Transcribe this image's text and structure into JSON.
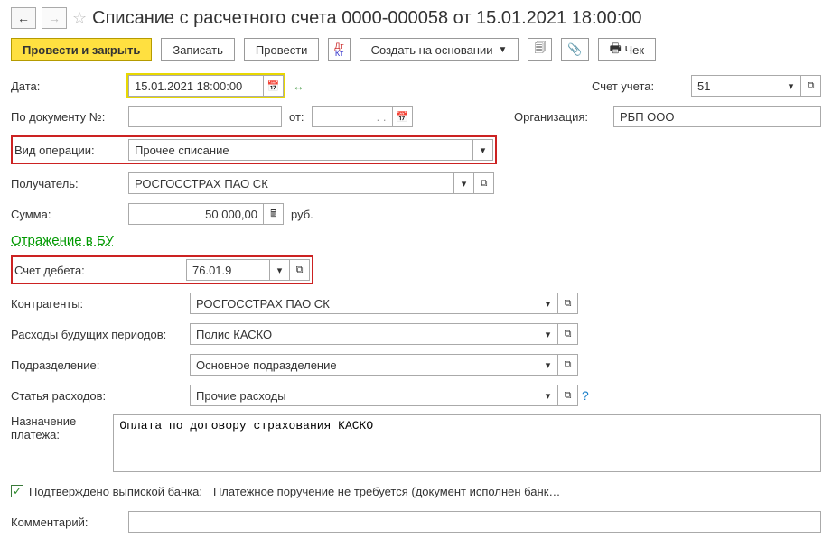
{
  "title": "Списание с расчетного счета 0000-000058 от 15.01.2021 18:00:00",
  "toolbar": {
    "submit_close": "Провести и закрыть",
    "save": "Записать",
    "submit": "Провести",
    "create_based": "Создать на основании",
    "check": "Чек"
  },
  "fields": {
    "date_label": "Дата:",
    "date_value": "15.01.2021 18:00:00",
    "docnum_label": "По документу №:",
    "docnum_from": "от:",
    "docnum_dots": ". .",
    "account_label": "Счет учета:",
    "account_value": "51",
    "org_label": "Организация:",
    "org_value": "РБП ООО",
    "optype_label": "Вид операции:",
    "optype_value": "Прочее списание",
    "recipient_label": "Получатель:",
    "recipient_value": "РОСГОССТРАХ ПАО СК",
    "sum_label": "Сумма:",
    "sum_value": "50 000,00",
    "currency": "руб.",
    "section": "Отражение в БУ",
    "debit_label": "Счет дебета:",
    "debit_value": "76.01.9",
    "contragent_label": "Контрагенты:",
    "contragent_value": "РОСГОССТРАХ ПАО СК",
    "future_label": "Расходы будущих периодов:",
    "future_value": "Полис КАСКО",
    "division_label": "Подразделение:",
    "division_value": "Основное подразделение",
    "expense_label": "Статья расходов:",
    "expense_value": "Прочие расходы",
    "purpose_label": "Назначение платежа:",
    "purpose_value": "Оплата по договору страхования КАСКО",
    "confirmed_label": "Подтверждено выпиской банка:",
    "bank_note": "Платежное поручение не требуется (документ исполнен банк…",
    "comment_label": "Комментарий:"
  }
}
